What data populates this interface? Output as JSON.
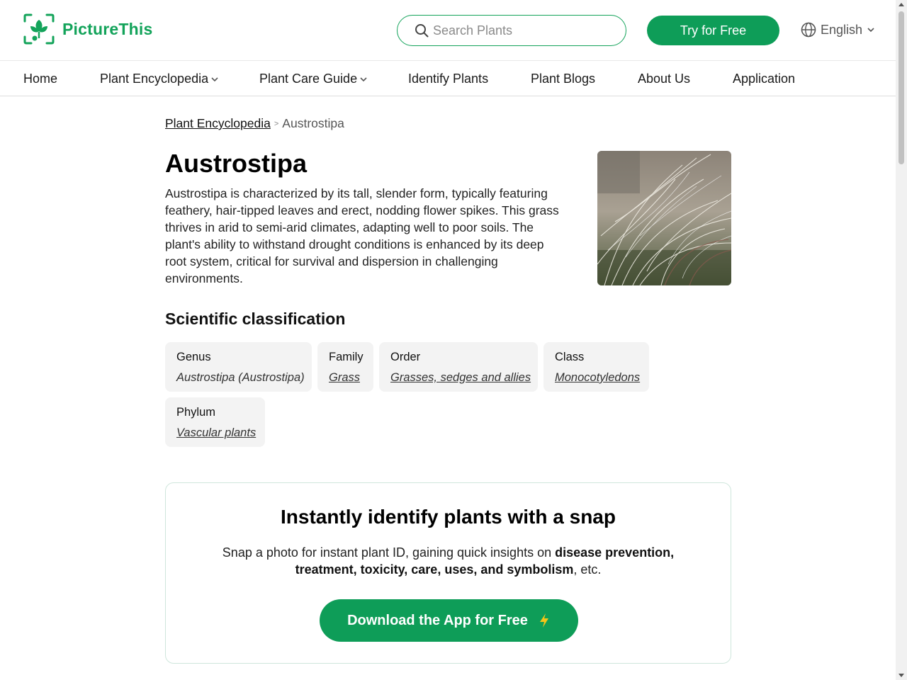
{
  "brand": {
    "name": "PictureThis",
    "color": "#13a35a"
  },
  "search": {
    "placeholder": "Search Plants"
  },
  "header": {
    "try_label": "Try for Free",
    "language": "English"
  },
  "nav": {
    "items": [
      {
        "label": "Home"
      },
      {
        "label": "Plant Encyclopedia",
        "has_dropdown": true
      },
      {
        "label": "Plant Care Guide",
        "has_dropdown": true
      },
      {
        "label": "Identify Plants"
      },
      {
        "label": "Plant Blogs"
      },
      {
        "label": "About Us"
      },
      {
        "label": "Application"
      }
    ]
  },
  "breadcrumb": {
    "parent": "Plant Encyclopedia",
    "separator": ">",
    "current": "Austrostipa"
  },
  "plant": {
    "name": "Austrostipa",
    "description": "Austrostipa is characterized by its tall, slender form, typically featuring feathery, hair-tipped leaves and erect, nodding flower spikes. This grass thrives in arid to semi-arid climates, adapting well to poor soils. The plant's ability to withstand drought conditions is enhanced by its deep root system, critical for survival and dispersion in challenging environments."
  },
  "classification": {
    "heading": "Scientific classification",
    "items": [
      {
        "label": "Genus",
        "value": "Austrostipa (Austrostipa)",
        "link": false
      },
      {
        "label": "Family",
        "value": "Grass",
        "link": true
      },
      {
        "label": "Order",
        "value": "Grasses, sedges and allies",
        "link": true
      },
      {
        "label": "Class",
        "value": "Monocotyledons",
        "link": true
      },
      {
        "label": "Phylum",
        "value": "Vascular plants",
        "link": true
      }
    ]
  },
  "promo": {
    "title": "Instantly identify plants with a snap",
    "text_lead": "Snap a photo for instant plant ID, gaining quick insights on ",
    "text_bold": "disease prevention, treatment, toxicity, care, uses, and symbolism",
    "text_tail": ", etc.",
    "button_label": "Download the App for Free"
  },
  "colors": {
    "accent": "#0e9d58",
    "bolt": "#f5c518"
  }
}
